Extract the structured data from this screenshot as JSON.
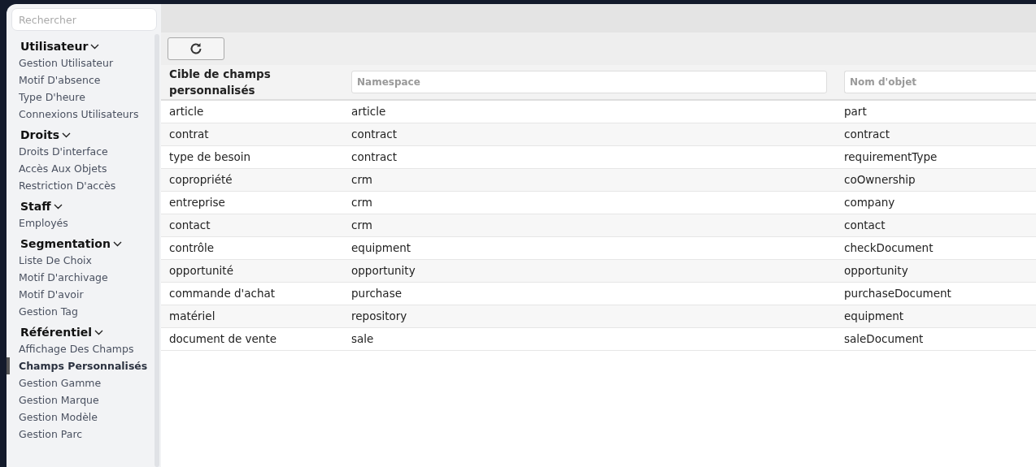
{
  "sidebar": {
    "search": {
      "placeholder": "Rechercher"
    },
    "groups": [
      {
        "title": "Utilisateur",
        "expanded": true,
        "items": [
          {
            "label": "Gestion Utilisateur",
            "selected": false
          },
          {
            "label": "Motif D'absence",
            "selected": false
          },
          {
            "label": "Type D'heure",
            "selected": false
          },
          {
            "label": "Connexions Utilisateurs",
            "selected": false
          }
        ]
      },
      {
        "title": "Droits",
        "expanded": true,
        "items": [
          {
            "label": "Droits D'interface",
            "selected": false
          },
          {
            "label": "Accès Aux Objets",
            "selected": false
          },
          {
            "label": "Restriction D'accès",
            "selected": false
          }
        ]
      },
      {
        "title": "Staff",
        "expanded": true,
        "items": [
          {
            "label": "Employés",
            "selected": false
          }
        ]
      },
      {
        "title": "Segmentation",
        "expanded": true,
        "items": [
          {
            "label": "Liste De Choix",
            "selected": false
          },
          {
            "label": "Motif D'archivage",
            "selected": false
          },
          {
            "label": "Motif D'avoir",
            "selected": false
          },
          {
            "label": "Gestion Tag",
            "selected": false
          }
        ]
      },
      {
        "title": "Référentiel",
        "expanded": true,
        "items": [
          {
            "label": "Affichage Des Champs",
            "selected": false
          },
          {
            "label": "Champs Personnalisés",
            "selected": true
          },
          {
            "label": "Gestion Gamme",
            "selected": false
          },
          {
            "label": "Gestion Marque",
            "selected": false
          },
          {
            "label": "Gestion Modèle",
            "selected": false
          },
          {
            "label": "Gestion Parc",
            "selected": false
          }
        ]
      }
    ]
  },
  "table": {
    "title": "Cible de champs personnalisés",
    "filters": [
      {
        "placeholder": "Namespace"
      },
      {
        "placeholder": "Nom d'objet"
      }
    ],
    "rows": [
      [
        "article",
        "article",
        "part"
      ],
      [
        "contrat",
        "contract",
        "contract"
      ],
      [
        "type de besoin",
        "contract",
        "requirementType"
      ],
      [
        "copropriété",
        "crm",
        "coOwnership"
      ],
      [
        "entreprise",
        "crm",
        "company"
      ],
      [
        "contact",
        "crm",
        "contact"
      ],
      [
        "contrôle",
        "equipment",
        "checkDocument"
      ],
      [
        "opportunité",
        "opportunity",
        "opportunity"
      ],
      [
        "commande d'achat",
        "purchase",
        "purchaseDocument"
      ],
      [
        "matériel",
        "repository",
        "equipment"
      ],
      [
        "document de vente",
        "sale",
        "saleDocument"
      ]
    ]
  }
}
